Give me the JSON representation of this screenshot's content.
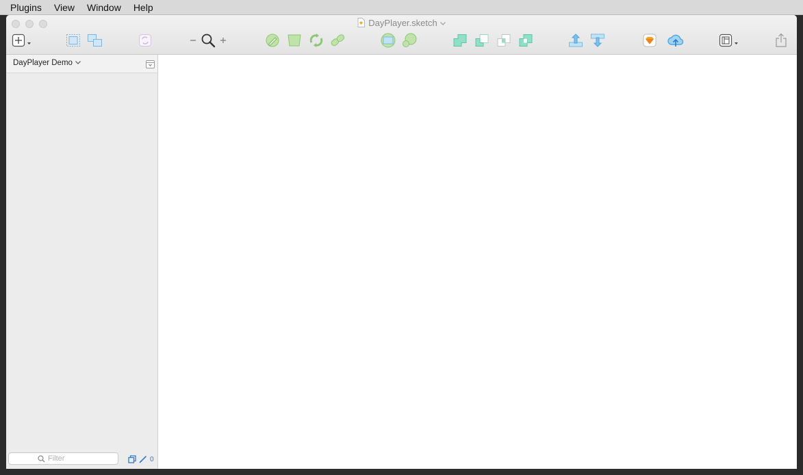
{
  "menubar": {
    "items": [
      "Plugins",
      "View",
      "Window",
      "Help"
    ]
  },
  "window": {
    "title": "DayPlayer.sketch"
  },
  "toolbar": {
    "icons": [
      "insert-icon",
      "group-icon",
      "ungroup-icon",
      "create-symbol-icon",
      "zoom-out-icon",
      "zoom-icon",
      "zoom-in-icon",
      "edit-icon",
      "transform-icon",
      "rotate-icon",
      "flatten-icon",
      "mask-icon",
      "scale-icon",
      "union-icon",
      "subtract-icon",
      "intersect-icon",
      "difference-icon",
      "forward-icon",
      "backward-icon",
      "sketch-icon",
      "cloud-icon",
      "view-icon",
      "export-icon"
    ]
  },
  "sidebar": {
    "page_title": "DayPlayer Demo",
    "filter_placeholder": "Filter",
    "count": "0"
  },
  "colors": {
    "accent": "#2a7ad6",
    "green": "#a8d99a",
    "teal": "#7fdcc0",
    "blue": "#8cc9ef",
    "orange": "#f39a1d"
  }
}
